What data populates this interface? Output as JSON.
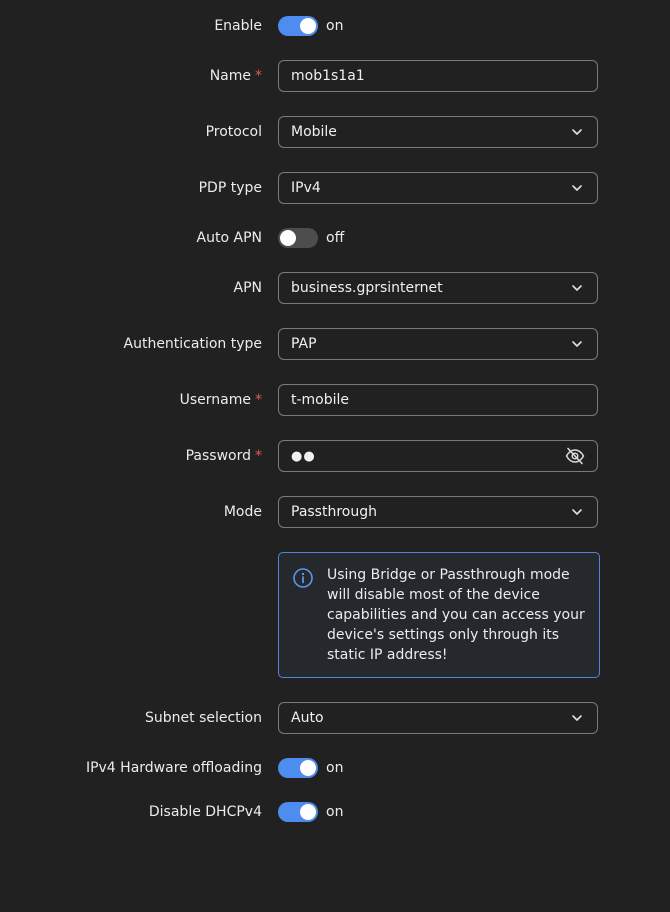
{
  "enable": {
    "label": "Enable",
    "state": "on",
    "checked": true
  },
  "name": {
    "label": "Name",
    "required_mark": "*",
    "value": "mob1s1a1"
  },
  "protocol": {
    "label": "Protocol",
    "value": "Mobile"
  },
  "pdp_type": {
    "label": "PDP type",
    "value": "IPv4"
  },
  "auto_apn": {
    "label": "Auto APN",
    "state": "off",
    "checked": false
  },
  "apn": {
    "label": "APN",
    "value": "business.gprsinternet"
  },
  "auth_type": {
    "label": "Authentication type",
    "value": "PAP"
  },
  "username": {
    "label": "Username",
    "required_mark": "*",
    "value": "t-mobile"
  },
  "password": {
    "label": "Password",
    "required_mark": "*",
    "masked_value": "●●"
  },
  "mode": {
    "label": "Mode",
    "value": "Passthrough"
  },
  "notice": {
    "text": "Using Bridge or Passthrough mode will disable most of the device capabilities and you can access your device's settings only through its static IP address!"
  },
  "subnet_selection": {
    "label": "Subnet selection",
    "value": "Auto"
  },
  "ipv4_hw_offloading": {
    "label": "IPv4 Hardware offloading",
    "state": "on",
    "checked": true
  },
  "disable_dhcpv4": {
    "label": "Disable DHCPv4",
    "state": "on",
    "checked": true
  },
  "icons": {
    "dropdown": "chevron-down-icon",
    "password_visibility": "eye-slash-icon",
    "notice": "info-icon"
  },
  "colors": {
    "background": "#212121",
    "toggle_on": "#4e8cf0",
    "toggle_off": "#4d4d4d",
    "required": "#e05b4b",
    "notice_border": "#4f87d8"
  }
}
